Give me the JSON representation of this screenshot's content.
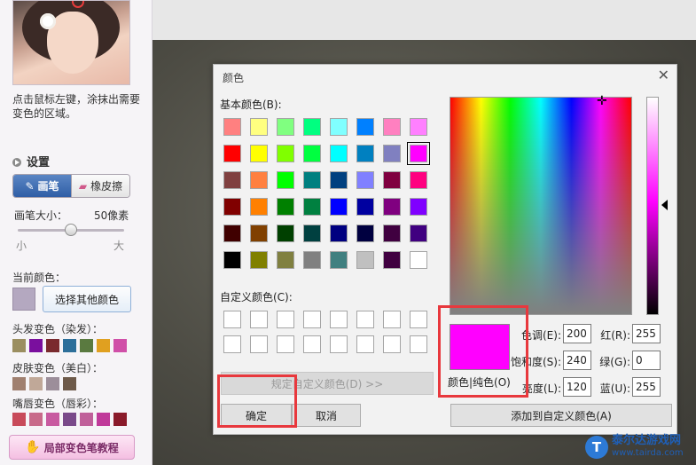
{
  "left_panel": {
    "hint": "点击鼠标左键，涂抹出需要变色的区域。",
    "settings_title": "设置",
    "tools": {
      "brush": "画笔",
      "eraser": "橡皮擦"
    },
    "brush_size": {
      "label": "画笔大小：",
      "value": "50像素",
      "min": "小",
      "max": "大",
      "level": 0.5
    },
    "current_color": {
      "label": "当前颜色：",
      "color": "#b4a8c0",
      "button": "选择其他颜色"
    },
    "groups": [
      {
        "label": "头发变色（染发）：",
        "colors": [
          "#9b8e60",
          "#7a0f9e",
          "#7a2a2e",
          "#2d6f9a",
          "#5a7a40",
          "#e0a020",
          "#d04fa8"
        ]
      },
      {
        "label": "皮肤变色（美白）：",
        "colors": [
          "#a08070",
          "#c0a898",
          "#9c8e9a",
          "#6e5a4a"
        ]
      },
      {
        "label": "嘴唇变色（唇彩）：",
        "colors": [
          "#c84a5a",
          "#c86a8a",
          "#c85aa0",
          "#7a4a8a",
          "#c0609a",
          "#c03a9a",
          "#8a1a2a"
        ]
      }
    ],
    "tutorial_button": "局部变色笔教程"
  },
  "dialog": {
    "title": "颜色",
    "close": "✕",
    "basic_label": "基本颜色(B):",
    "basic_colors": [
      "#ff8080",
      "#ffff80",
      "#80ff80",
      "#00ff80",
      "#80ffff",
      "#0080ff",
      "#ff80c0",
      "#ff80ff",
      "#ff0000",
      "#ffff00",
      "#80ff00",
      "#00ff40",
      "#00ffff",
      "#0080c0",
      "#8080c0",
      "#ff00ff",
      "#804040",
      "#ff8040",
      "#00ff00",
      "#008080",
      "#004080",
      "#8080ff",
      "#800040",
      "#ff0080",
      "#800000",
      "#ff8000",
      "#008000",
      "#008040",
      "#0000ff",
      "#0000a0",
      "#800080",
      "#8000ff",
      "#400000",
      "#804000",
      "#004000",
      "#004040",
      "#000080",
      "#000040",
      "#400040",
      "#400080",
      "#000000",
      "#808000",
      "#808040",
      "#808080",
      "#408080",
      "#c0c0c0",
      "#400040",
      "#ffffff"
    ],
    "selected_index": 15,
    "custom_label": "自定义颜色(C):",
    "define_button": "规定自定义颜色(D) >>",
    "ok_button": "确定",
    "cancel_button": "取消",
    "preview_color": "#ff00ff",
    "preview_label": "颜色|纯色(O)",
    "fields": {
      "hue": {
        "label": "色调(E):",
        "value": "200"
      },
      "sat": {
        "label": "饱和度(S):",
        "value": "240"
      },
      "lum": {
        "label": "亮度(L):",
        "value": "120"
      },
      "red": {
        "label": "红(R):",
        "value": "255"
      },
      "green": {
        "label": "绿(G):",
        "value": "0"
      },
      "blue": {
        "label": "蓝(U):",
        "value": "255"
      }
    },
    "add_custom_button": "添加到自定义颜色(A)"
  },
  "watermark": {
    "logo": "T",
    "name": "泰尔达游戏网",
    "url": "www.tairda.com"
  },
  "annotation_color": "#e8383d"
}
